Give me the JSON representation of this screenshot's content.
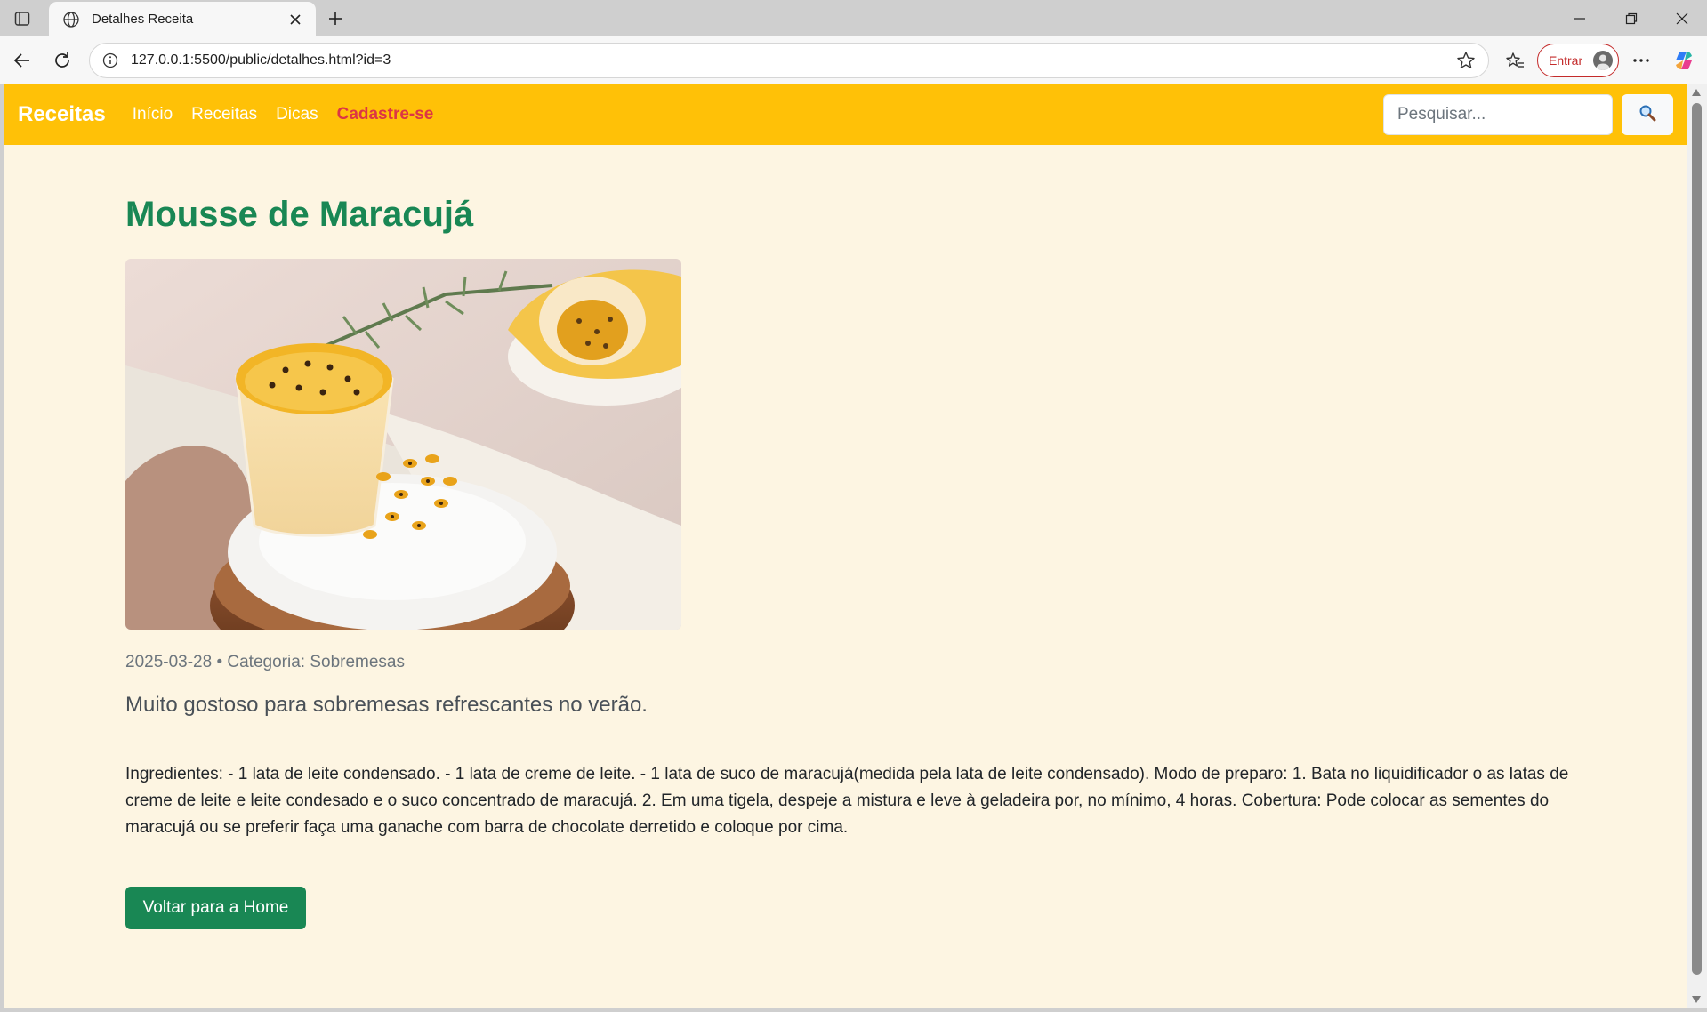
{
  "browser": {
    "tab_title": "Detalhes Receita",
    "url": "127.0.0.1:5500/public/detalhes.html?id=3",
    "signin_label": "Entrar"
  },
  "navbar": {
    "brand": "Receitas",
    "links": [
      {
        "label": "Início"
      },
      {
        "label": "Receitas"
      },
      {
        "label": "Dicas"
      },
      {
        "label": "Cadastre-se"
      }
    ],
    "search_placeholder": "Pesquisar...",
    "search_icon": "magnifier-icon"
  },
  "recipe": {
    "title": "Mousse de Maracujá",
    "meta": "2025-03-28 • Categoria: Sobremesas",
    "lead": "Muito gostoso para sobremesas refrescantes no verão.",
    "body": "Ingredientes: - 1 lata de leite condensado. - 1 lata de creme de leite. - 1 lata de suco de maracujá(medida pela lata de leite condensado). Modo de preparo: 1. Bata no liquidificador o as latas de creme de leite e leite condesado e o suco concentrado de maracujá. 2. Em uma tigela, despeje a mistura e leve à geladeira por, no mínimo, 4 horas. Cobertura: Pode colocar as sementes do maracujá ou se preferir faça uma ganache com barra de chocolate derretido e coloque por cima.",
    "back_button": "Voltar para a Home"
  },
  "colors": {
    "navbar_bg": "#ffc107",
    "page_bg": "#fdf5e2",
    "title_green": "#198754",
    "cta_red": "#dc3545"
  }
}
